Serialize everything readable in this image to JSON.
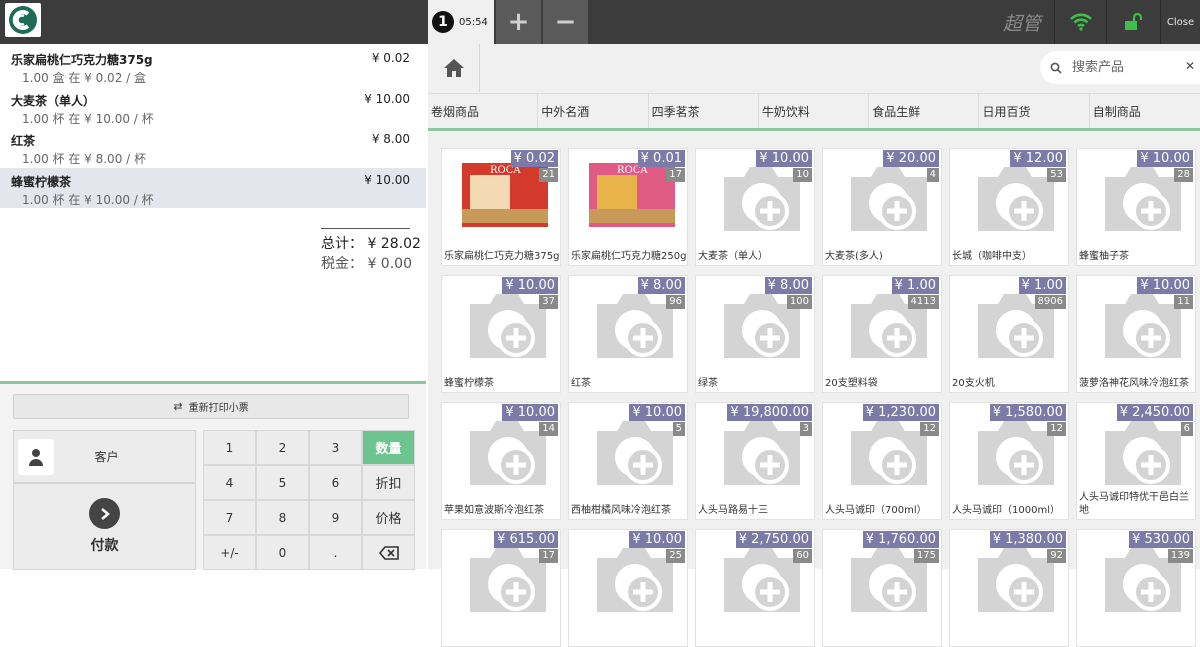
{
  "topbar": {
    "order_number": "1",
    "order_time": "05:54",
    "add_label": "+",
    "remove_label": "−",
    "manager_label": "超管",
    "close_label": "Close"
  },
  "colors": {
    "accent_green": "#8ec5a0",
    "price_tag": "#7c7aa6",
    "stock_tag": "#8a8a8a",
    "wifi": "#3fbf4a",
    "lock": "#3fbf4a"
  },
  "order": {
    "lines": [
      {
        "name": "乐家扁桃仁巧克力糖375g",
        "price": "¥ 0.02",
        "detail": "1.00 盒 在 ¥ 0.02 / 盒"
      },
      {
        "name": "大麦茶（单人）",
        "price": "¥ 10.00",
        "detail": "1.00 杯 在 ¥ 10.00 / 杯"
      },
      {
        "name": "红茶",
        "price": "¥ 8.00",
        "detail": "1.00 杯 在 ¥ 8.00 / 杯"
      },
      {
        "name": "蜂蜜柠檬茶",
        "price": "¥ 10.00",
        "detail": "1.00 杯 在 ¥ 10.00 / 杯"
      }
    ],
    "total": "总计： ¥ 28.02",
    "tax": "税金： ¥ 0.00"
  },
  "actions": {
    "reprint_label": "重新打印小票",
    "customer_label": "客户",
    "pay_label": "付款"
  },
  "numpad": [
    "1",
    "2",
    "3",
    "数量",
    "4",
    "5",
    "6",
    "折扣",
    "7",
    "8",
    "9",
    "价格",
    "+/-",
    "0",
    "."
  ],
  "search": {
    "placeholder": "搜索产品"
  },
  "categories": [
    "卷烟商品",
    "中外名酒",
    "四季茗茶",
    "牛奶饮料",
    "食品生鲜",
    "日用百货",
    "自制商品"
  ],
  "products": [
    {
      "name": "乐家扁桃仁巧克力糖375g",
      "price": "¥ 0.02",
      "stock": "21",
      "image": "roca-box-red"
    },
    {
      "name": "乐家扁桃仁巧克力糖250g",
      "price": "¥ 0.01",
      "stock": "17",
      "image": "roca-box-pink"
    },
    {
      "name": "大麦茶（单人）",
      "price": "¥ 10.00",
      "stock": "10",
      "image": "camera-icon"
    },
    {
      "name": "大麦茶(多人)",
      "price": "¥ 20.00",
      "stock": "4",
      "image": "camera-icon"
    },
    {
      "name": "长城（咖啡中支）",
      "price": "¥ 12.00",
      "stock": "53",
      "image": "camera-icon"
    },
    {
      "name": "蜂蜜柚子茶",
      "price": "¥ 10.00",
      "stock": "28",
      "image": "camera-icon"
    },
    {
      "name": "蜂蜜柠檬茶",
      "price": "¥ 10.00",
      "stock": "37",
      "image": "camera-icon"
    },
    {
      "name": "红茶",
      "price": "¥ 8.00",
      "stock": "96",
      "image": "camera-icon"
    },
    {
      "name": "绿茶",
      "price": "¥ 8.00",
      "stock": "100",
      "image": "camera-icon"
    },
    {
      "name": "20支塑料袋",
      "price": "¥ 1.00",
      "stock": "4113",
      "image": "camera-icon"
    },
    {
      "name": "20支火机",
      "price": "¥ 1.00",
      "stock": "8906",
      "image": "camera-icon"
    },
    {
      "name": "菠萝洛神花风味冷泡红茶",
      "price": "¥ 10.00",
      "stock": "11",
      "image": "camera-icon"
    },
    {
      "name": "苹果如意波斯冷泡红茶",
      "price": "¥ 10.00",
      "stock": "14",
      "image": "camera-icon"
    },
    {
      "name": "西柚柑橘风味冷泡红茶",
      "price": "¥ 10.00",
      "stock": "5",
      "image": "camera-icon"
    },
    {
      "name": "人头马路易十三",
      "price": "¥ 19,800.00",
      "stock": "3",
      "image": "camera-icon"
    },
    {
      "name": "人头马诚印（700ml）",
      "price": "¥ 1,230.00",
      "stock": "12",
      "image": "camera-icon"
    },
    {
      "name": "人头马诚印（1000ml）",
      "price": "¥ 1,580.00",
      "stock": "12",
      "image": "camera-icon"
    },
    {
      "name": "人头马诚印特优干邑白兰地",
      "price": "¥ 2,450.00",
      "stock": "6",
      "image": "camera-icon"
    },
    {
      "name": "",
      "price": "¥ 615.00",
      "stock": "17",
      "image": "camera-icon"
    },
    {
      "name": "",
      "price": "¥ 10.00",
      "stock": "25",
      "image": "camera-icon"
    },
    {
      "name": "",
      "price": "¥ 2,750.00",
      "stock": "60",
      "image": "camera-icon"
    },
    {
      "name": "",
      "price": "¥ 1,760.00",
      "stock": "175",
      "image": "camera-icon"
    },
    {
      "name": "",
      "price": "¥ 1,380.00",
      "stock": "92",
      "image": "camera-icon"
    },
    {
      "name": "",
      "price": "¥ 530.00",
      "stock": "139",
      "image": "camera-icon"
    }
  ]
}
